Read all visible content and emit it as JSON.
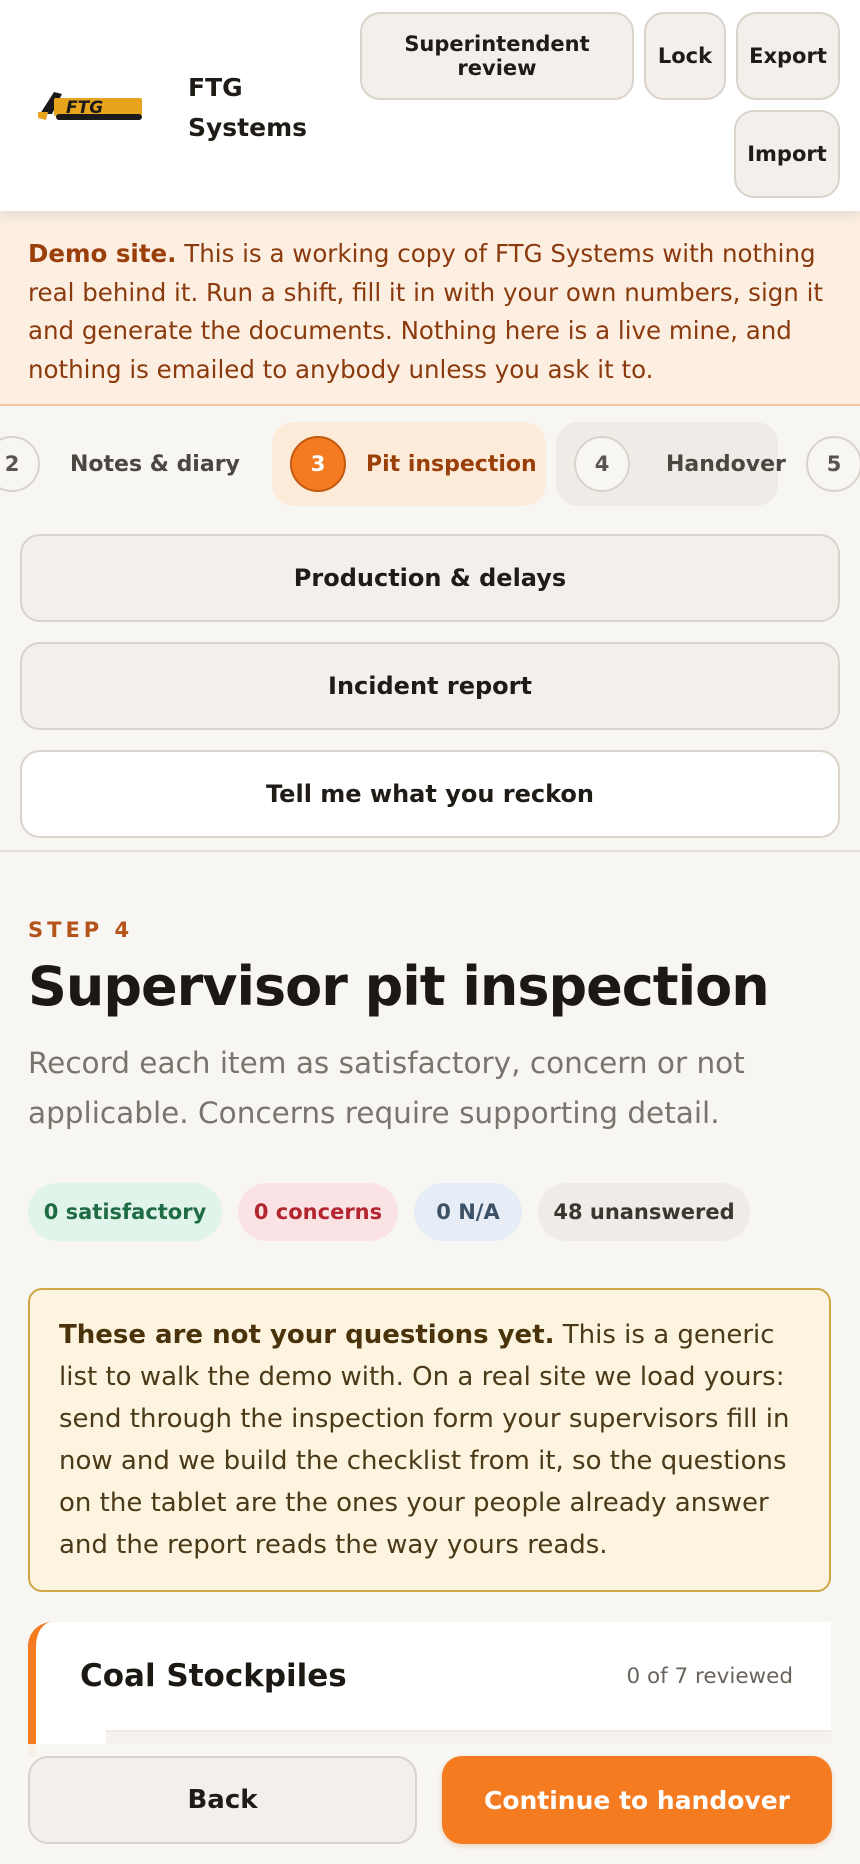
{
  "header": {
    "brand_line1": "FTG",
    "brand_line2": "Systems",
    "logo_text": "FTG",
    "buttons": {
      "review": "Superintendent review",
      "lock": "Lock",
      "export": "Export",
      "import": "Import"
    }
  },
  "demo_banner": {
    "lead": "Demo site.",
    "body": "This is a working copy of FTG Systems with nothing real behind it. Run a shift, fill it in with your own numbers, sign it and generate the documents. Nothing here is a live mine, and nothing is emailed to anybody unless you ask it to."
  },
  "stepper": {
    "steps": [
      {
        "num": "2",
        "label": "Notes & diary"
      },
      {
        "num": "3",
        "label": "Pit inspection"
      },
      {
        "num": "4",
        "label": "Handover"
      },
      {
        "num": "5",
        "label": ""
      }
    ],
    "active_step": "3",
    "actions": {
      "production": "Production & delays",
      "incident": "Incident report",
      "feedback": "Tell me what you reckon"
    }
  },
  "page": {
    "eyebrow": "STEP 4",
    "title": "Supervisor pit inspection",
    "subtitle": "Record each item as satisfactory, concern or not applicable. Concerns require supporting detail."
  },
  "summary": {
    "satisfactory": "0 satisfactory",
    "concerns": "0 concerns",
    "na": "0 N/A",
    "unanswered": "48 unanswered"
  },
  "notice": {
    "lead": "These are not your questions yet.",
    "body": "This is a generic list to walk the demo with. On a real site we load yours: send through the inspection form your supervisors fill in now and we build the checklist from it, so the questions on the tablet are the ones your people already answer and the report reads the way yours reads."
  },
  "section": {
    "title": "Coal Stockpiles",
    "count": "0 of 7 reviewed"
  },
  "footer": {
    "back": "Back",
    "continue": "Continue to handover"
  },
  "colors": {
    "accent": "#f47b20",
    "banner_bg": "#fcefe2",
    "notice_bg": "#fdf4e0"
  },
  "icons": [
    "ftg-excavator-logo"
  ]
}
